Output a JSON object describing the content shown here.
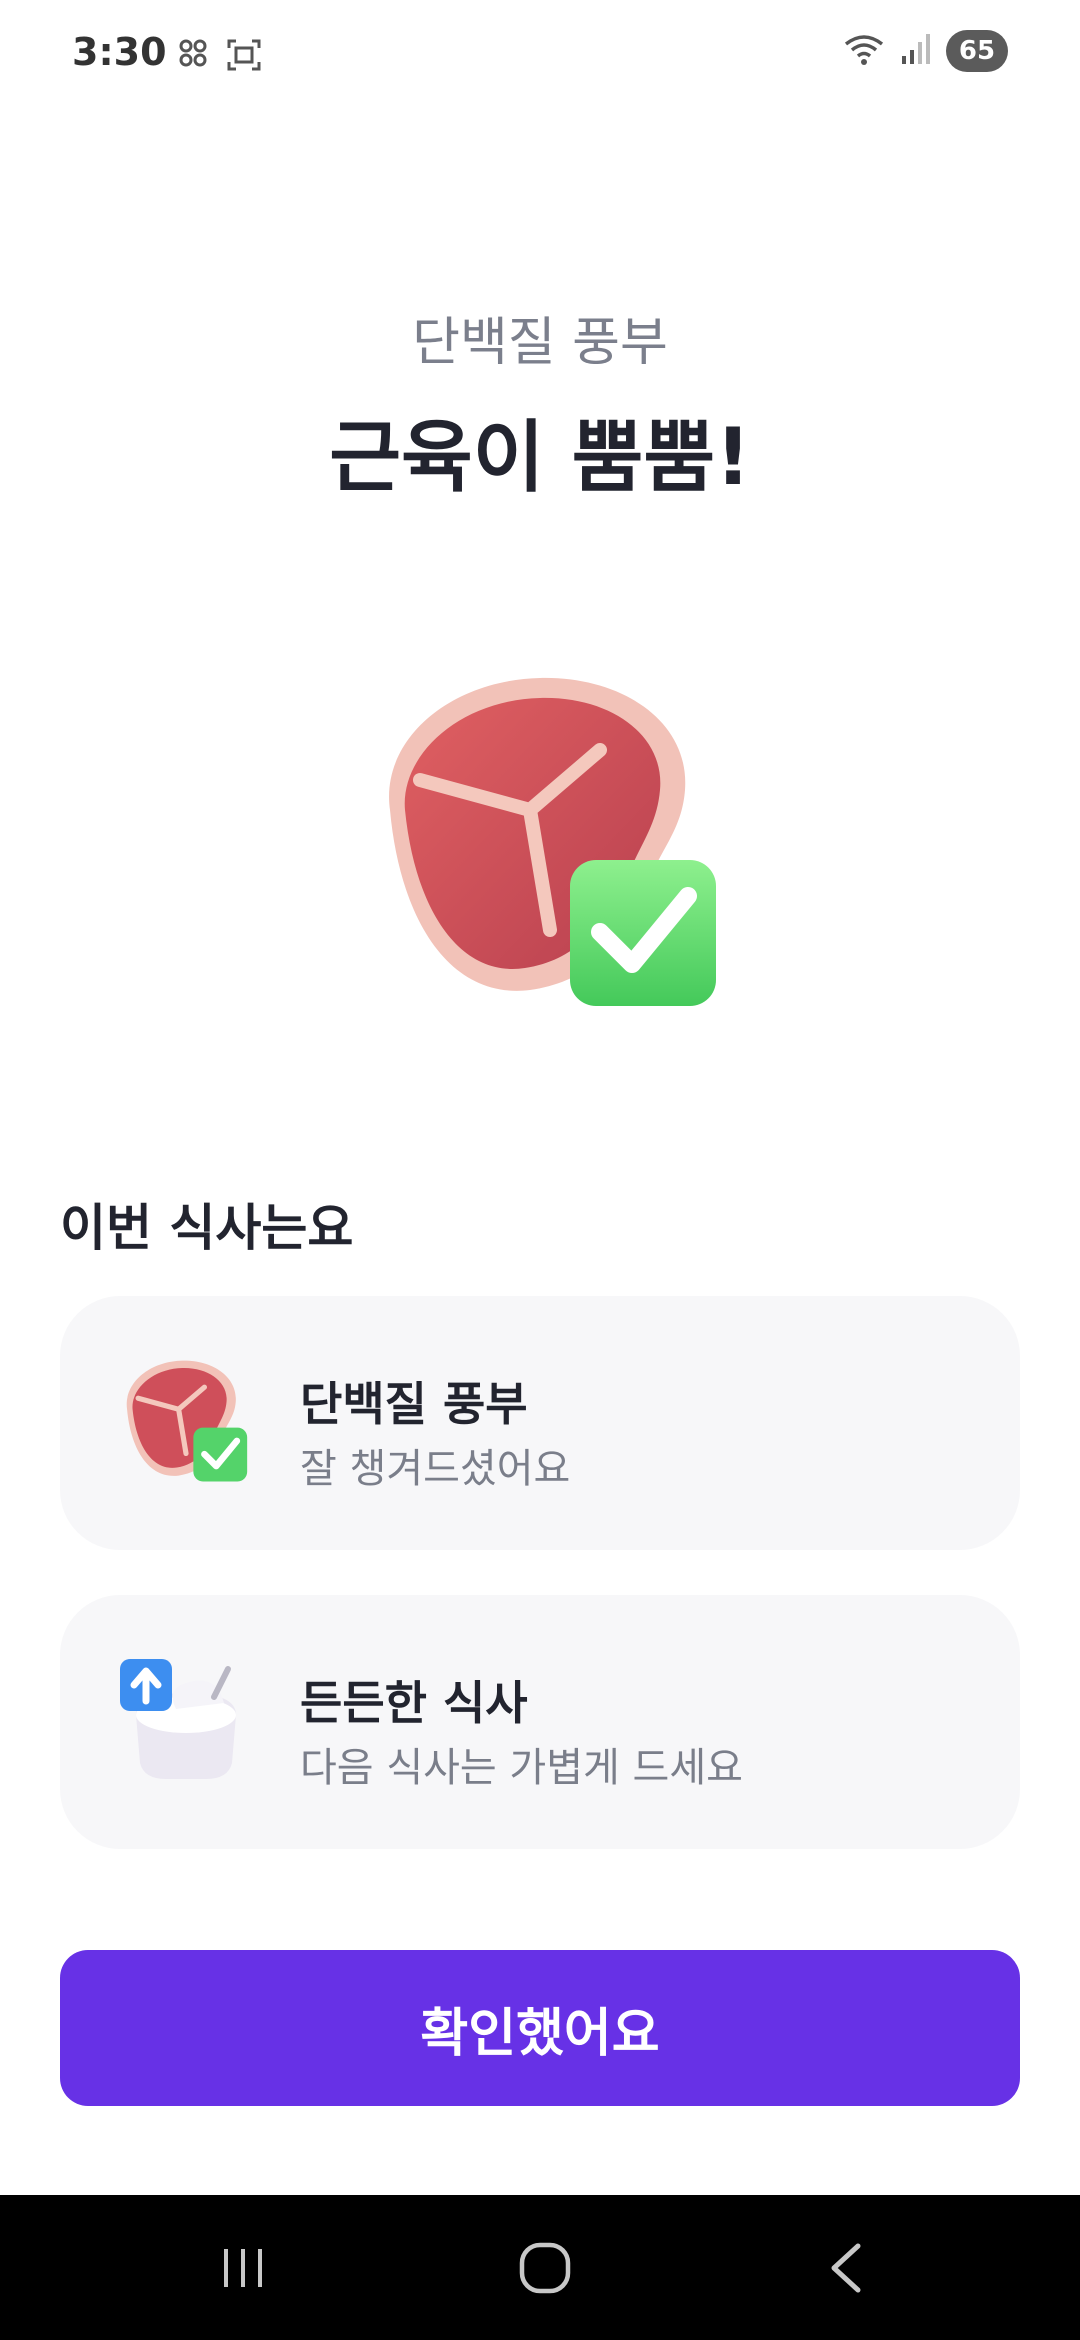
{
  "status_bar": {
    "time": "3:30",
    "battery": "65"
  },
  "header": {
    "subtitle": "단백질 풍부",
    "title": "근육이 뿜뿜!"
  },
  "section": {
    "title": "이번 식사는요"
  },
  "cards": [
    {
      "title": "단백질 풍부",
      "subtitle": "잘 챙겨드셨어요",
      "icon": "meat-check-icon"
    },
    {
      "title": "든든한 식사",
      "subtitle": "다음 식사는 가볍게 드세요",
      "icon": "bowl-arrow-up-icon"
    }
  ],
  "confirm_button": {
    "label": "확인했어요"
  },
  "colors": {
    "accent": "#6731e6",
    "card_bg": "#f7f7f9",
    "check_green": "#54d36a"
  }
}
